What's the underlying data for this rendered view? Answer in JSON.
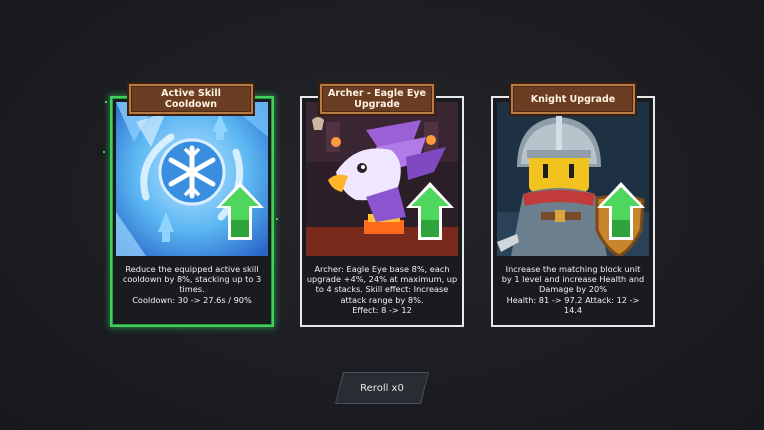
{
  "cards": [
    {
      "title": "Active Skill Cooldown",
      "desc": [
        "Reduce the equipped active skill",
        "cooldown by 8%, stacking up to 3",
        "times.",
        "Cooldown: 30 -> 27.6s / 90%"
      ],
      "selected": true
    },
    {
      "title_line1": "Archer - Eagle Eye",
      "title_line2": "Upgrade",
      "desc": [
        "Archer: Eagle Eye base 8%, each",
        "upgrade +4%, 24% at maximum, up",
        "to 4 stacks. Skill effect: Increase",
        "attack range by 8%.",
        "Effect: 8 -> 12"
      ],
      "selected": false
    },
    {
      "title": "Knight Upgrade",
      "desc": [
        "Increase the matching block unit",
        "by 1 level and increase Health and",
        "Damage by 20%",
        "Health: 81 -> 97.2  Attack: 12 ->",
        "14.4"
      ],
      "selected": false
    }
  ],
  "reroll_label": "Reroll x0",
  "colors": {
    "selected_border": "#3fd25a",
    "banner": "#6b3d22",
    "upgrade_arrow": "#4fd65c"
  },
  "icons": [
    "snowflake-icon",
    "eagle-icon",
    "knight-icon",
    "upgrade-arrow-icon"
  ]
}
